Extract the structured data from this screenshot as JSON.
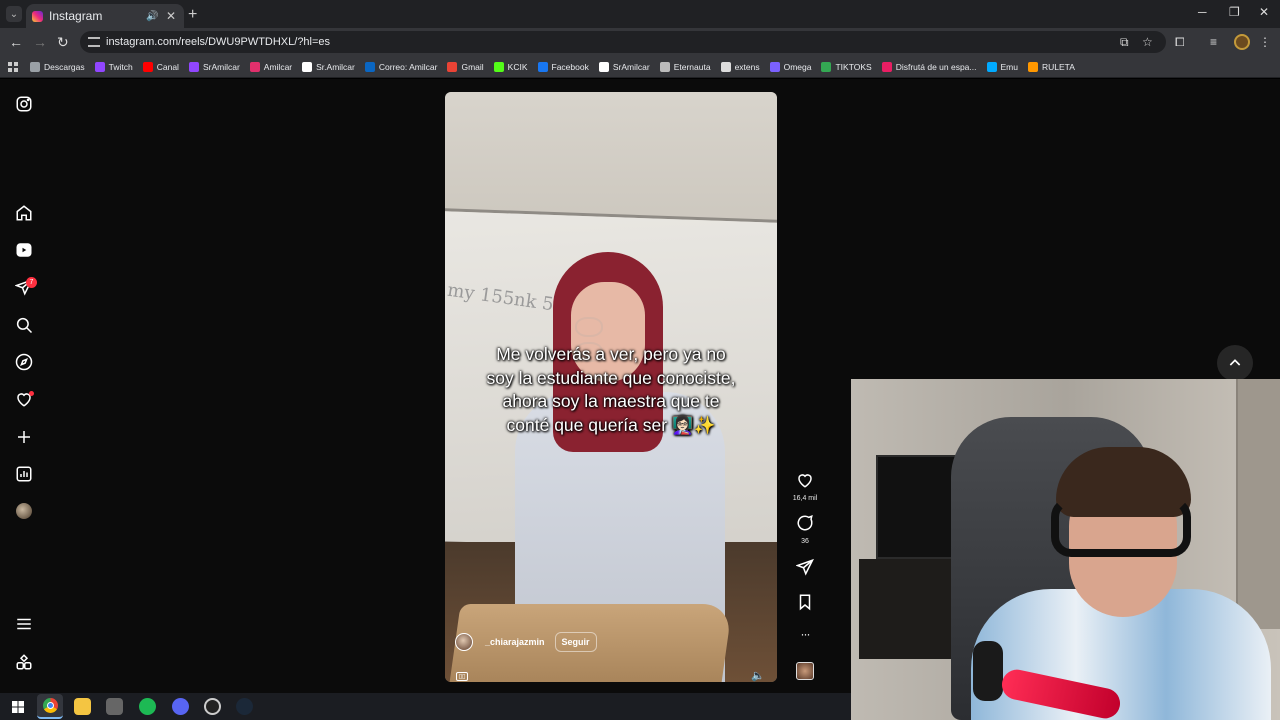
{
  "browser": {
    "tab_title": "Instagram",
    "url": "instagram.com/reels/DWU9PWTDHXL/?hl=es",
    "new_tab_symbol": "+",
    "bookmarks": [
      {
        "label": "Descargas",
        "color": "#9aa0a6"
      },
      {
        "label": "Twitch",
        "color": "#9146ff"
      },
      {
        "label": "Canal",
        "color": "#ff0000"
      },
      {
        "label": "SrAmilcar",
        "color": "#9146ff"
      },
      {
        "label": "Amilcar",
        "color": "#e1306c"
      },
      {
        "label": "Sr.Amilcar",
        "color": "#ffffff"
      },
      {
        "label": "Correo: Amilcar",
        "color": "#0a66c2"
      },
      {
        "label": "Gmail",
        "color": "#ea4335"
      },
      {
        "label": "KCIK",
        "color": "#53fc18"
      },
      {
        "label": "Facebook",
        "color": "#1877f2"
      },
      {
        "label": "SrAmilcar",
        "color": "#ffffff"
      },
      {
        "label": "Eternauta",
        "color": "#bbbbbb"
      },
      {
        "label": "extens",
        "color": "#dddddd"
      },
      {
        "label": "Omega",
        "color": "#7b61ff"
      },
      {
        "label": "TIKTOKS",
        "color": "#34a853"
      },
      {
        "label": "Disfrutá de un espa...",
        "color": "#e91e63"
      },
      {
        "label": "Emu",
        "color": "#00aaff"
      },
      {
        "label": "RULETA",
        "color": "#ff9800"
      }
    ]
  },
  "reel": {
    "caption": "Me volverás a ver, pero ya no soy la estudiante que conociste, ahora soy la maestra que te conté que quería ser 👩🏻‍🏫✨",
    "board_text": "my 155nk 5",
    "username": "_chiarajazmin",
    "follow_label": "Seguir",
    "likes": "16,4 mil",
    "comments": "36",
    "more_symbol": "···"
  },
  "sidebar": {
    "notification_count": "7"
  },
  "colors": {
    "background": "#0b0b0b",
    "badge_red": "#ff3040",
    "chrome_dark": "#202124",
    "chrome_mid": "#35363a"
  }
}
